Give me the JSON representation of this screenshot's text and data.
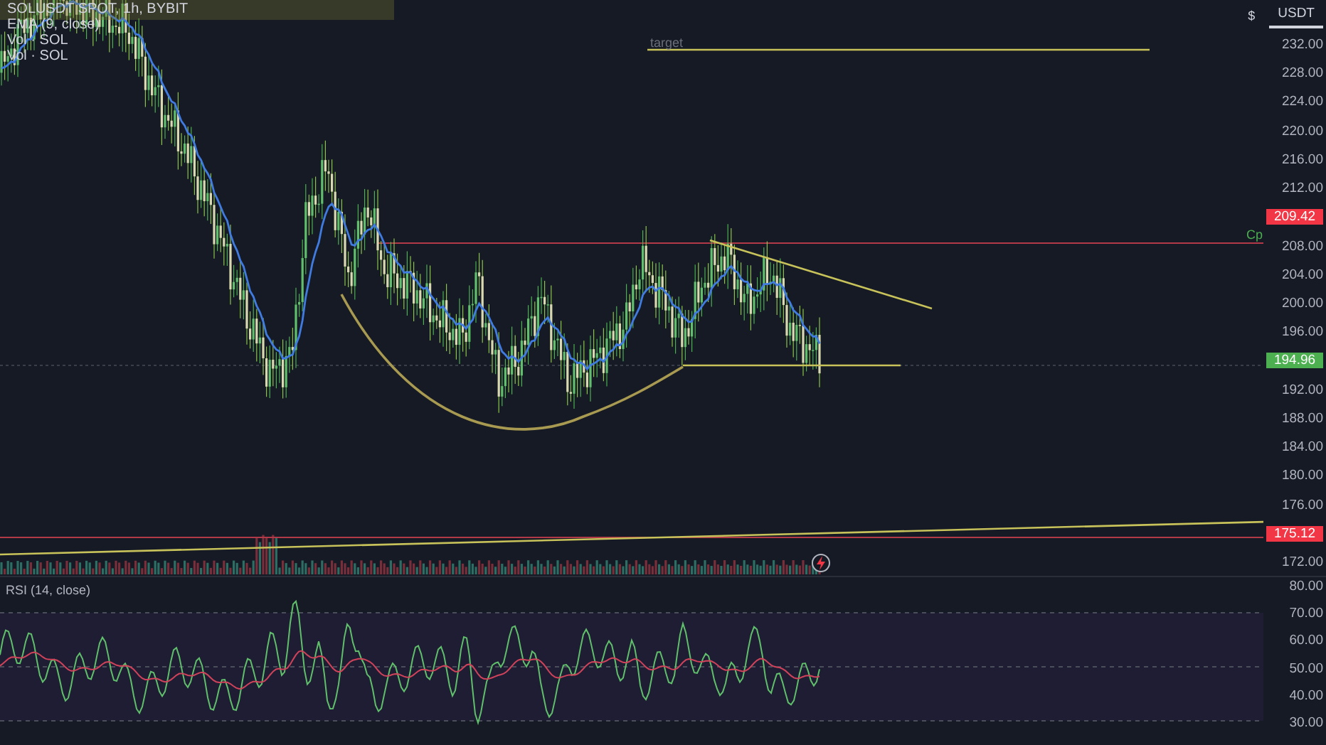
{
  "legend": {
    "symbol": "SOLUSDT SPOT, 1h, BYBIT",
    "indicators": [
      "EMA (9, close)",
      "Vol · SOL",
      "Vol · SOL"
    ]
  },
  "currency": {
    "symbol": "$",
    "button": "USDT"
  },
  "price_chart": {
    "drawing_labels": [
      {
        "kind": "target",
        "text": "target"
      },
      {
        "kind": "cp",
        "text": "Cp"
      }
    ],
    "axis": [
      {
        "kind": "tick",
        "text": "232.00"
      },
      {
        "kind": "tick",
        "text": "228.00"
      },
      {
        "kind": "tick",
        "text": "224.00"
      },
      {
        "kind": "tick",
        "text": "220.00"
      },
      {
        "kind": "tick",
        "text": "216.00"
      },
      {
        "kind": "tick",
        "text": "212.00"
      },
      {
        "kind": "badge",
        "text": "209.42",
        "color": "#f23645"
      },
      {
        "kind": "tick",
        "text": "208.00"
      },
      {
        "kind": "tick",
        "text": "204.00"
      },
      {
        "kind": "tick",
        "text": "200.00"
      },
      {
        "kind": "tick",
        "text": "196.00"
      },
      {
        "kind": "badge",
        "text": "194.96",
        "color": "#4caf50"
      },
      {
        "kind": "tick",
        "text": "192.00"
      },
      {
        "kind": "tick",
        "text": "188.00"
      },
      {
        "kind": "tick",
        "text": "184.00"
      },
      {
        "kind": "tick",
        "text": "180.00"
      },
      {
        "kind": "tick",
        "text": "176.00"
      },
      {
        "kind": "badge",
        "text": "175.12",
        "color": "#f23645"
      },
      {
        "kind": "tick",
        "text": "172.00"
      }
    ]
  },
  "rsi": {
    "title": "RSI (14, close)",
    "axis": [
      "80.00",
      "70.00",
      "60.00",
      "50.00",
      "40.00",
      "30.00"
    ]
  }
}
